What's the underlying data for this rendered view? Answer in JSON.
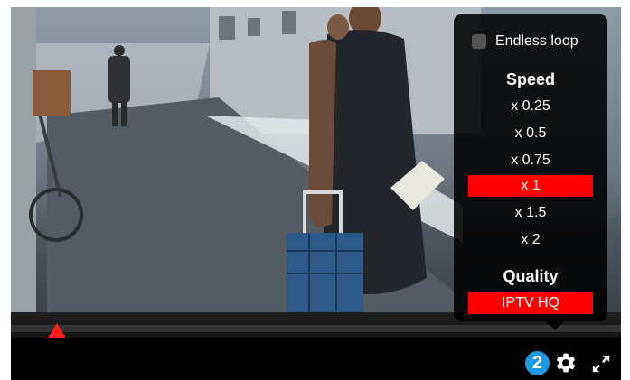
{
  "menu": {
    "loop_label": "Endless loop",
    "loop_checked": false,
    "speed_title": "Speed",
    "speed_options": [
      "x 0.25",
      "x 0.5",
      "x 0.75",
      "x 1",
      "x 1.5",
      "x 2"
    ],
    "speed_selected": "x 1",
    "quality_title": "Quality",
    "quality_options": [
      "IPTV HQ"
    ],
    "quality_selected": "IPTV HQ"
  },
  "controls": {
    "badge": "2",
    "settings_icon": "gear-icon",
    "fullscreen_icon": "fullscreen-icon"
  },
  "colors": {
    "accent": "#ff0000",
    "badge": "#1e9be0",
    "menu_bg": "#000000"
  }
}
